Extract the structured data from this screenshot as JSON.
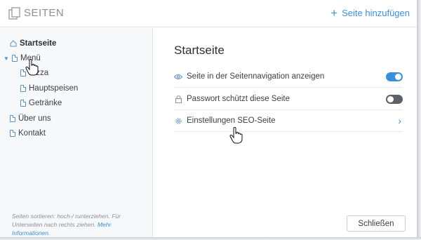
{
  "header": {
    "title": "SEITEN",
    "add_label": "Seite hinzufügen"
  },
  "sidebar": {
    "items": [
      {
        "label": "Startseite",
        "icon": "home-icon",
        "active": true
      },
      {
        "label": "Menü",
        "icon": "page-icon",
        "expanded": true
      },
      {
        "label": "Pizza",
        "icon": "page-icon"
      },
      {
        "label": "Hauptspeisen",
        "icon": "page-icon"
      },
      {
        "label": "Getränke",
        "icon": "page-icon"
      },
      {
        "label": "Über uns",
        "icon": "page-icon"
      },
      {
        "label": "Kontakt",
        "icon": "page-icon"
      }
    ],
    "help_text": "Seiten sortieren: hoch-/ runterziehen. Für Unterseiten nach rechts ziehen.",
    "help_link": "Mehr Informationen."
  },
  "main": {
    "title": "Startseite",
    "settings": [
      {
        "label": "Seite in der Seitennavigation anzeigen",
        "icon": "eye-icon",
        "control": "toggle",
        "state": "on"
      },
      {
        "label": "Passwort schützt diese Seite",
        "icon": "lock-icon",
        "control": "toggle",
        "state": "off"
      },
      {
        "label": "Einstellungen SEO-Seite",
        "icon": "gear-icon",
        "control": "chevron"
      }
    ],
    "close_label": "Schließen"
  },
  "colors": {
    "accent": "#3b8fd6",
    "toggle_off": "#5c6166",
    "sidebar_bg": "#f7f8f9"
  }
}
